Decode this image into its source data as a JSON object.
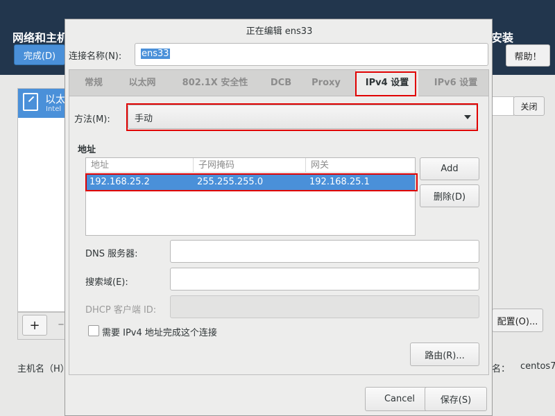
{
  "background": {
    "title": "网络和主机",
    "title_right": "安装",
    "done_label": "完成(D)",
    "help_label": "帮助！",
    "list_item_label": "以太",
    "list_item_sub": "Intel",
    "close_label": "关闭",
    "plus_label": "+",
    "minus_label": "–",
    "config_label": "配置(O)...",
    "hostname_label": "主机名（H）",
    "hostname_right_label": "名：",
    "hostname_value": "centos7"
  },
  "dialog": {
    "title": "正在编辑 ens33",
    "connection_name_label": "连接名称(N):",
    "connection_name_value": "ens33",
    "tabs": [
      {
        "label": "常规"
      },
      {
        "label": "以太网"
      },
      {
        "label": "802.1X 安全性"
      },
      {
        "label": "DCB"
      },
      {
        "label": "Proxy"
      },
      {
        "label": "IPv4 设置"
      },
      {
        "label": "IPv6 设置"
      }
    ],
    "active_tab": "IPv4 设置",
    "method_label": "方法(M):",
    "method_value": "手动",
    "address_heading": "地址",
    "address_table": {
      "columns": [
        "地址",
        "子网掩码",
        "网关"
      ],
      "rows": [
        {
          "address": "192.168.25.2",
          "netmask": "255.255.255.0",
          "gateway": "192.168.25.1"
        }
      ]
    },
    "add_label": "Add",
    "delete_label": "删除(D)",
    "dns_label": "DNS 服务器:",
    "dns_value": "",
    "search_domain_label": "搜索域(E):",
    "search_domain_value": "",
    "dhcp_client_id_label": "DHCP 客户端 ID:",
    "dhcp_client_id_value": "",
    "require_ipv4_label": "需要 IPv4 地址完成这个连接",
    "require_ipv4_checked": false,
    "routes_label": "路由(R)...",
    "cancel_label": "Cancel",
    "save_label": "保存(S)"
  },
  "colors": {
    "selection": "#4a90d9",
    "highlight_box": "#e00000",
    "header_bg": "#22364d"
  }
}
